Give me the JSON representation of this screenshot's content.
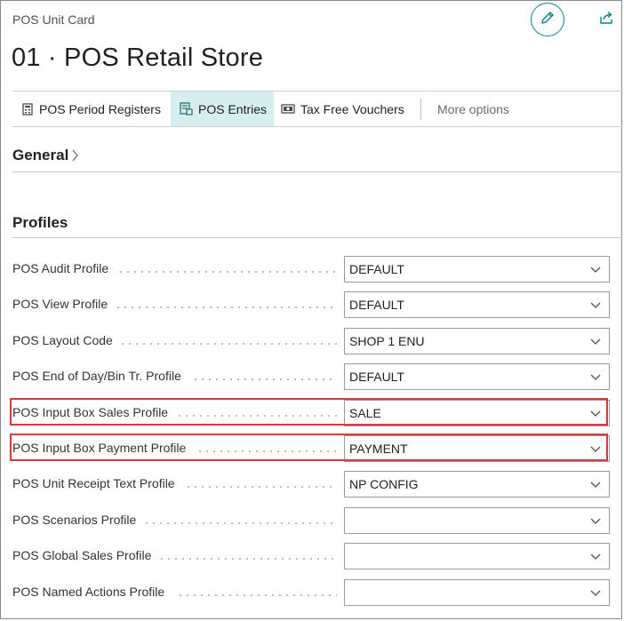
{
  "header": {
    "caption": "POS Unit Card",
    "title": "01 · POS Retail Store"
  },
  "actions": [
    {
      "label": "POS Period Registers",
      "icon": "register-icon"
    },
    {
      "label": "POS Entries",
      "icon": "entries-icon",
      "active": true
    },
    {
      "label": "Tax Free Vouchers",
      "icon": "voucher-icon"
    },
    {
      "label": "More options"
    }
  ],
  "sections": {
    "general": "General",
    "profiles": "Profiles"
  },
  "fields": [
    {
      "label": "POS Audit Profile",
      "value": "DEFAULT"
    },
    {
      "label": "POS View Profile",
      "value": "DEFAULT"
    },
    {
      "label": "POS Layout Code",
      "value": "SHOP 1 ENU"
    },
    {
      "label": "POS End of Day/Bin Tr. Profile",
      "value": "DEFAULT"
    },
    {
      "label": "POS Input Box Sales Profile",
      "value": "SALE",
      "highlighted": true
    },
    {
      "label": "POS Input Box Payment Profile",
      "value": "PAYMENT",
      "highlighted": true
    },
    {
      "label": "POS Unit Receipt Text Profile",
      "value": "NP CONFIG"
    },
    {
      "label": "POS Scenarios Profile",
      "value": ""
    },
    {
      "label": "POS Global Sales Profile",
      "value": ""
    },
    {
      "label": "POS Named Actions Profile",
      "value": ""
    }
  ],
  "colors": {
    "accent": "#008489",
    "active_tab_bg": "#d6eef0",
    "highlight": "#e0353a"
  }
}
